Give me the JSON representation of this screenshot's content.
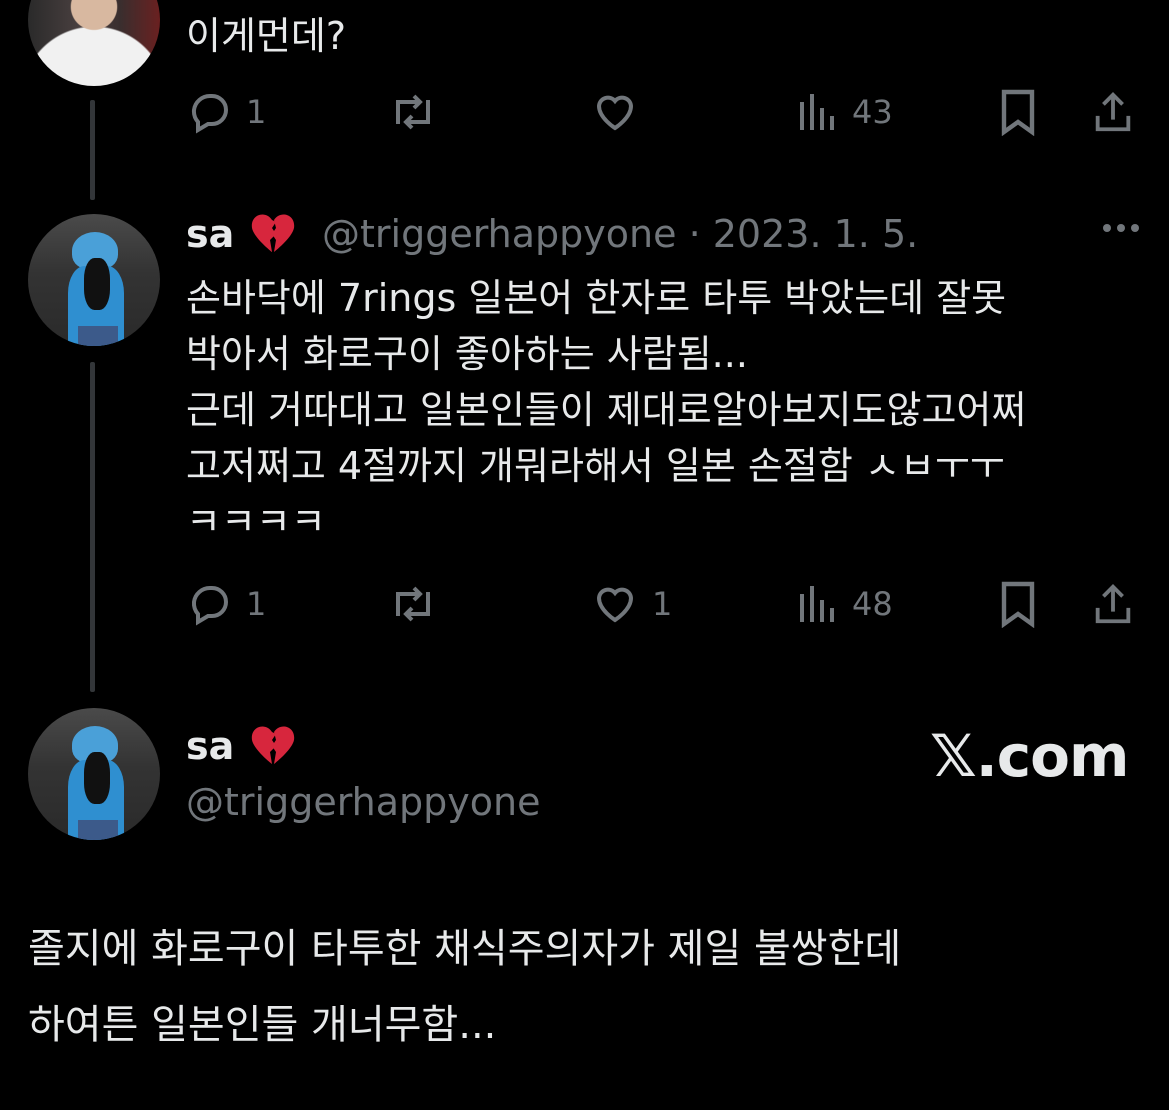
{
  "top_tweet": {
    "text": "이게먼데?",
    "actions": {
      "reply_count": "1",
      "retweet_count": "",
      "like_count": "",
      "views_count": "43"
    }
  },
  "reply_tweet": {
    "display_name": "sa",
    "handle": "@triggerhappyone",
    "separator": "·",
    "date": "2023. 1. 5.",
    "lines": [
      "손바닥에 7rings 일본어 한자로 타투 박았는데 잘못",
      "박아서 화로구이 좋아하는 사람됨...",
      "근데 거따대고 일본인들이 제대로알아보지도않고어쩌",
      "고저쩌고 4절까지 개뭐라해서 일본 손절함 ㅅㅂㅜㅜ",
      "ㅋㅋㅋㅋ"
    ],
    "actions": {
      "reply_count": "1",
      "retweet_count": "",
      "like_count": "1",
      "views_count": "48"
    }
  },
  "main_tweet": {
    "display_name": "sa",
    "handle": "@triggerhappyone",
    "watermark": "𝕏.com",
    "lines": [
      "졸지에 화로구이 타투한 채식주의자가 제일 불쌍한데",
      "하여튼 일본인들 개너무함..."
    ]
  },
  "colors": {
    "background": "#000000",
    "text": "#e7e9ea",
    "muted": "#71767b",
    "thread_line": "#333639"
  },
  "icons": [
    "reply-icon",
    "retweet-icon",
    "like-icon",
    "views-icon",
    "bookmark-icon",
    "share-icon",
    "more-icon",
    "broken-heart-emoji"
  ]
}
